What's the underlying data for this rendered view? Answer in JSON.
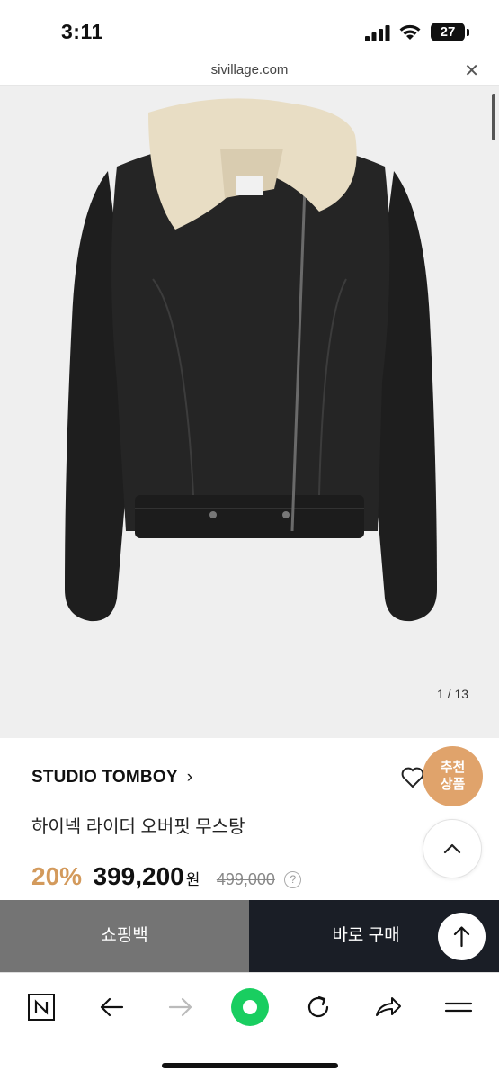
{
  "status_bar": {
    "time": "3:11",
    "battery": "27"
  },
  "browser": {
    "url": "sivillage.com",
    "close_icon": "close-icon"
  },
  "gallery": {
    "counter": "1 / 13",
    "image": "black leather rider jacket with cream shearling collar"
  },
  "product": {
    "brand": "STUDIO TOMBOY",
    "brand_chevron": "›",
    "name": "하이넥 라이더 오버핏 무스탕",
    "discount": "20%",
    "price": "399,200",
    "currency": "원",
    "original_price": "499,000",
    "info": "?"
  },
  "recommend": {
    "line1": "추천",
    "line2": "상품"
  },
  "actions": {
    "cart_label": "쇼핑백",
    "buy_label": "바로 구매"
  },
  "toolbar": {
    "icons": [
      "naver-icon",
      "back-icon",
      "forward-icon",
      "green-dot-icon",
      "reload-icon",
      "share-icon",
      "menu-icon"
    ]
  },
  "colors": {
    "discount": "#d39a5c",
    "recommend_bg": "#e0a36b",
    "cart_bg": "#747474",
    "buy_bg": "#1a1e26",
    "green": "#19ce60"
  }
}
